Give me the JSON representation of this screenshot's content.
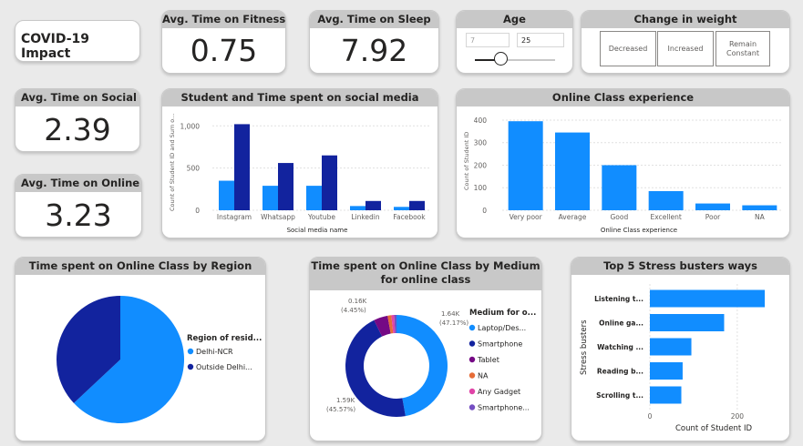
{
  "title": "COVID-19 Impact",
  "kpis": {
    "fitness": {
      "label": "Avg. Time on Fitness",
      "value": "0.75"
    },
    "sleep": {
      "label": "Avg. Time on Sleep",
      "value": "7.92"
    },
    "social": {
      "label": "Avg. Time on Social m...",
      "value": "2.39"
    },
    "online": {
      "label": "Avg. Time on Online cl...",
      "value": "3.23"
    }
  },
  "age": {
    "label": "Age",
    "min": "7",
    "max": "25"
  },
  "weight": {
    "label": "Change in weight",
    "buttons": [
      "Decreased",
      "Increased",
      "Remain Constant"
    ]
  },
  "social_chart": {
    "title": "Student and Time spent on social media",
    "ylabel": "Count of Student ID and Sum o...",
    "xlabel": "Social media name",
    "ticks": [
      "1,000",
      "500",
      "0"
    ],
    "colors": {
      "series1": "#118dff",
      "series2": "#12239e"
    },
    "chart_data": {
      "type": "bar",
      "categories": [
        "Instagram",
        "Whatsapp",
        "Youtube",
        "Linkedin",
        "Facebook"
      ],
      "series": [
        {
          "values": [
            350,
            290,
            290,
            50,
            40
          ]
        },
        {
          "values": [
            1020,
            560,
            650,
            110,
            110
          ]
        }
      ],
      "ylim": [
        0,
        1100
      ]
    }
  },
  "exp_chart": {
    "title": "Online Class experience",
    "ylabel": "Count of Student ID",
    "xlabel": "Online Class experience",
    "ticks": [
      "400",
      "300",
      "200",
      "100",
      "0"
    ],
    "chart_data": {
      "type": "bar",
      "categories": [
        "Very poor",
        "Average",
        "Good",
        "Excellent",
        "Poor",
        "NA"
      ],
      "values": [
        395,
        345,
        200,
        85,
        30,
        22
      ],
      "ylim": [
        0,
        420
      ]
    }
  },
  "region_chart": {
    "title": "Time spent on Online Class by Region",
    "legend_title": "Region of resid...",
    "chart_data": {
      "type": "pie",
      "labels": [
        "Delhi-NCR",
        "Outside Delhi..."
      ],
      "values": [
        63,
        37
      ],
      "colors": [
        "#118dff",
        "#12239e"
      ]
    }
  },
  "medium_chart": {
    "title": "Time spent on Online Class by Medium for online class",
    "legend_title": "Medium for o...",
    "annotations": {
      "a1": "1.64K",
      "a1p": "(47.17%)",
      "a2": "1.59K",
      "a2p": "(45.57%)",
      "a3": "0.16K",
      "a3p": "(4.45%)"
    },
    "chart_data": {
      "type": "pie",
      "labels": [
        "Laptop/Des...",
        "Smartphone",
        "Tablet",
        "NA",
        "Any Gadget",
        "Smartphone..."
      ],
      "values": [
        47.17,
        45.57,
        4.45,
        1.2,
        0.9,
        0.71
      ],
      "colors": [
        "#118dff",
        "#12239e",
        "#750985",
        "#e66c37",
        "#e044a7",
        "#744ec2"
      ]
    }
  },
  "stress_chart": {
    "title": "Top 5 Stress busters ways",
    "ylabel": "Stress busters",
    "xlabel": "Count of Student ID",
    "ticks": [
      "0",
      "200"
    ],
    "chart_data": {
      "type": "bar",
      "categories": [
        "Listening t...",
        "Online ga...",
        "Watching ...",
        "Reading b...",
        "Scrolling t..."
      ],
      "values": [
        263,
        170,
        95,
        75,
        72
      ],
      "xlim": [
        0,
        290
      ]
    }
  }
}
